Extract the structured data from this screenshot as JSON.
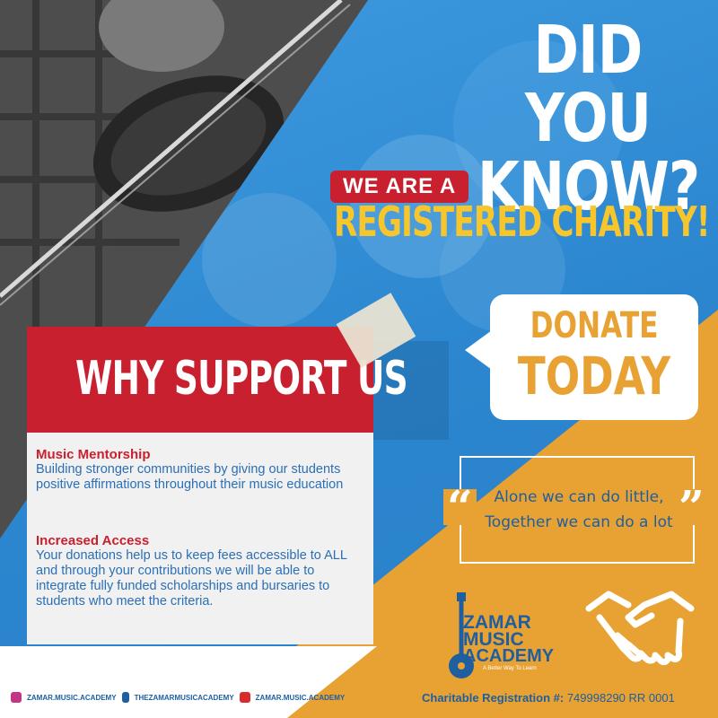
{
  "headline": {
    "line1": "DID YOU",
    "line2": "KNOW?",
    "badge": "WE ARE A",
    "subline": "REGISTERED CHARITY!"
  },
  "donate": {
    "line1": "DONATE",
    "line2": "TODAY"
  },
  "quote": {
    "open": "“",
    "line1": "Alone we can do little,",
    "line2": "Together we can do a lot",
    "close": "”"
  },
  "card": {
    "title": "WHY SUPPORT US",
    "sections": [
      {
        "title": "Music Mentorship",
        "text": "Building stronger communities by giving our students positive affirmations throughout their music education"
      },
      {
        "title": "Increased Access",
        "text": "Your donations help us to keep fees accessible to ALL and through your contributions we will be able to integrate fully funded scholarships and bursaries to students who meet the criteria."
      }
    ]
  },
  "logo": {
    "line1": "ZAMAR",
    "line2": "MUSIC",
    "line3": "ACADEMY",
    "tagline": "A Better Way To Learn"
  },
  "footer": {
    "social": [
      {
        "icon": "instagram-icon",
        "label": "ZAMAR.MUSIC.ACADEMY",
        "color": "#c13584"
      },
      {
        "icon": "facebook-icon",
        "label": "THEZAMARMUSICACADEMY",
        "color": "#1f5fa0"
      },
      {
        "icon": "youtube-icon",
        "label": "ZAMAR.MUSIC.ACADEMY",
        "color": "#d92b2b"
      }
    ],
    "registration_label": "Charitable Registration #:",
    "registration_number": "749998290 RR 0001"
  },
  "colors": {
    "blue": "#2b86cf",
    "red": "#c8202f",
    "orange": "#e8a233",
    "yellow": "#f6c62c",
    "navy": "#1f5fa0"
  }
}
